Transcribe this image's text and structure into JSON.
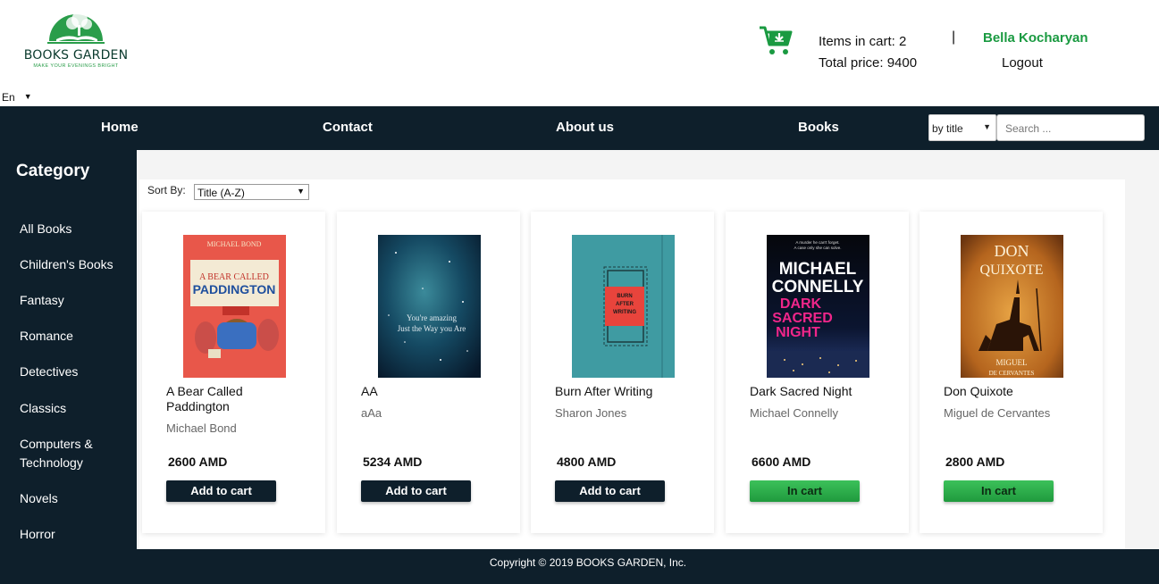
{
  "brand": {
    "name": "BOOKS GARDEN",
    "tagline": "MAKE YOUR EVENINGS BRIGHT",
    "green": "#2a9d4a"
  },
  "language": {
    "selected": "En"
  },
  "cart": {
    "items_text": "Items in cart: 2",
    "total_text": "Total price: 9400"
  },
  "user": {
    "separator": "|",
    "name": "Bella Kocharyan",
    "logout": "Logout"
  },
  "nav": {
    "items": [
      "Home",
      "Contact",
      "About us",
      "Books"
    ],
    "search_type": "by title",
    "search_placeholder": "Search ..."
  },
  "sidebar": {
    "title": "Category",
    "items": [
      "All Books",
      "Children's Books",
      "Fantasy",
      "Romance",
      "Detectives",
      "Classics",
      "Computers & Technology",
      "Novels",
      "Horror"
    ]
  },
  "sort": {
    "label": "Sort By:",
    "selected": "Title (A-Z)"
  },
  "books": [
    {
      "title": "A Bear Called Paddington",
      "author": "Michael Bond",
      "price": "2600 AMD",
      "button": "Add to cart",
      "in_cart": false,
      "cover_lines": [
        "MICHAEL BOND",
        "A BEAR CALLED",
        "PADDINGTON"
      ]
    },
    {
      "title": "AA",
      "author": "aAa",
      "price": "5234 AMD",
      "button": "Add to cart",
      "in_cart": false,
      "cover_lines": [
        "You're amazing",
        "Just the Way you Are"
      ]
    },
    {
      "title": "Burn After Writing",
      "author": "Sharon Jones",
      "price": "4800 AMD",
      "button": "Add to cart",
      "in_cart": false,
      "cover_lines": [
        "BURN",
        "AFTER",
        "WRITING"
      ]
    },
    {
      "title": "Dark Sacred Night",
      "author": "Michael Connelly",
      "price": "6600 AMD",
      "button": "In cart",
      "in_cart": true,
      "cover_lines": [
        "A murder he can't forget.",
        "A case only she can solve.",
        "MICHAEL",
        "CONNELLY",
        "DARK",
        "SACRED",
        "NIGHT"
      ]
    },
    {
      "title": "Don Quixote",
      "author": "Miguel de Cervantes",
      "price": "2800 AMD",
      "button": "In cart",
      "in_cart": true,
      "cover_lines": [
        "DON",
        "QUIXOTE",
        "MIGUEL",
        "DE CERVANTES"
      ]
    }
  ],
  "footer": {
    "text": "Copyright © 2019 BOOKS GARDEN, Inc."
  },
  "colors": {
    "navy": "#0e1f2b",
    "accent_green": "#1a9a41",
    "in_cart_green": "#2fb24f"
  }
}
